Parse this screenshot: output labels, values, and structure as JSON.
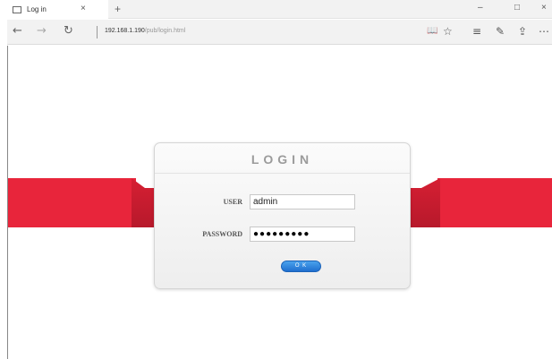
{
  "tab": {
    "title": "Log in",
    "close": "×",
    "new_tab": "+"
  },
  "window_buttons": {
    "minimize": "–",
    "maximize": "□",
    "close": "×"
  },
  "nav": {
    "back": "←",
    "forward": "→",
    "refresh": "↻"
  },
  "address": {
    "host": "192.168.1.190",
    "path": "/pub/login.html"
  },
  "toolbar_icons": {
    "reading_view": "📖",
    "favorite": "☆",
    "hub": "≡",
    "notes": "✎",
    "share": "⇪",
    "more": "⋯"
  },
  "login": {
    "title": "LOGIN",
    "user_label": "USER",
    "user_value": "admin",
    "password_label": "PASSWORD",
    "password_value": "●●●●●●●●●",
    "ok_label": "O K"
  },
  "colors": {
    "ribbon": "#e8253b",
    "ok_button": "#2a7fdc"
  }
}
